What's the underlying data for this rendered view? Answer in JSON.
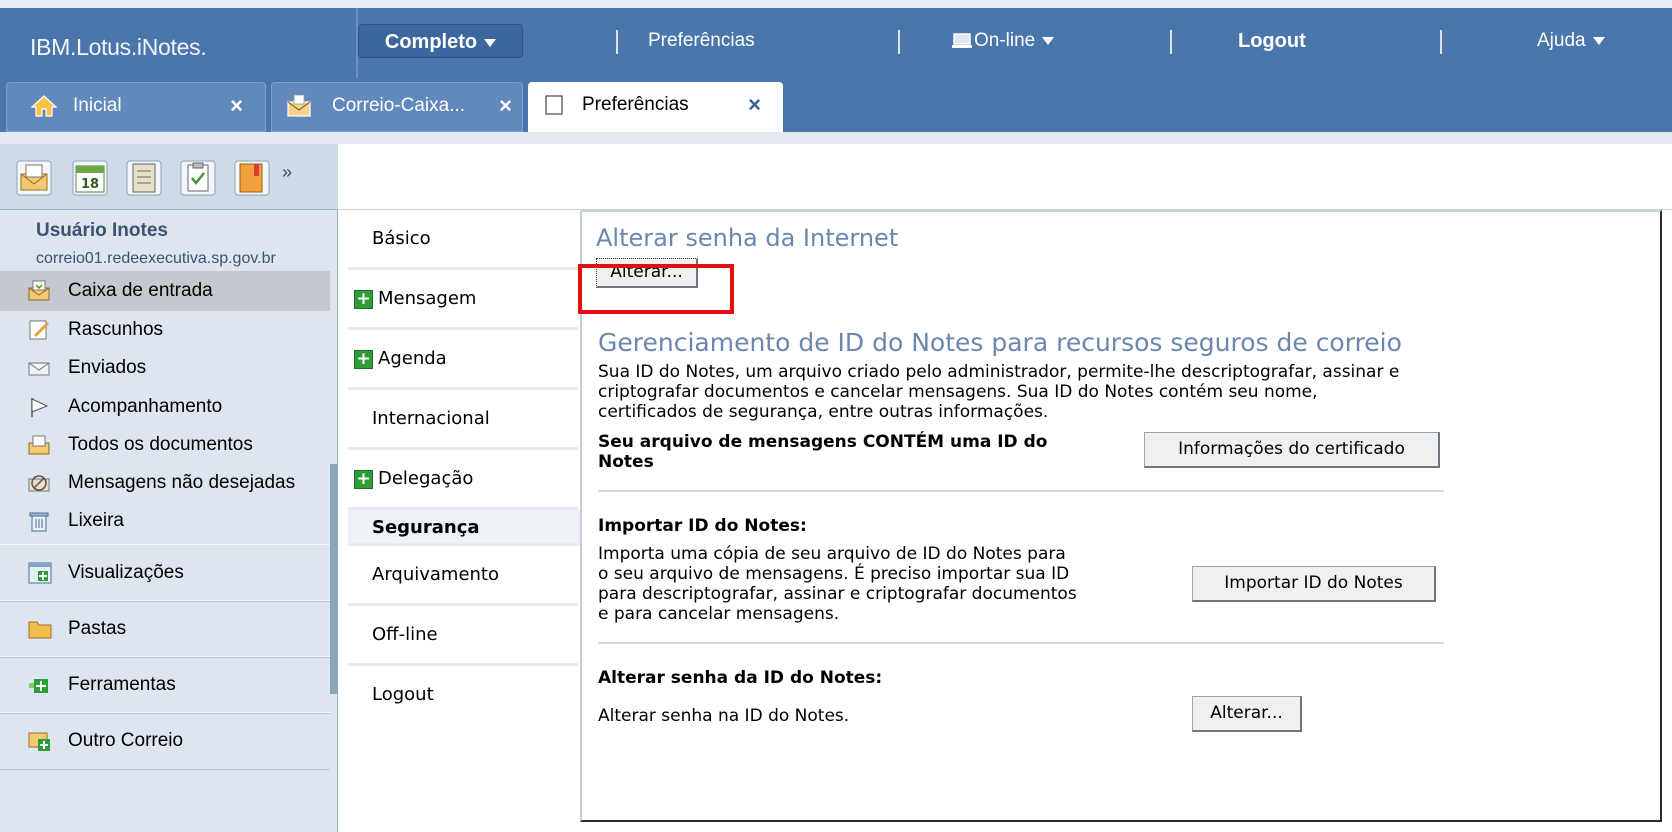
{
  "topbar": {
    "logo": "IBM.Lotus.iNotes.",
    "completo": "Completo",
    "preferencias": "Preferências",
    "online": "On-line",
    "logout": "Logout",
    "ajuda": "Ajuda"
  },
  "tabs": [
    {
      "label": "Inicial",
      "icon": "home-icon"
    },
    {
      "label": "Correio-Caixa...",
      "icon": "mail-icon"
    },
    {
      "label": "Preferências",
      "icon": "document-icon"
    }
  ],
  "tab_close": "×",
  "launcher": {
    "calendar_day": "18",
    "more": "»"
  },
  "user": {
    "name": "Usuário Inotes",
    "host": "correio01.redeexecutiva.sp.gov.br"
  },
  "nav_items": [
    {
      "label": "Caixa de entrada",
      "icon": "inbox-icon"
    },
    {
      "label": "Rascunhos",
      "icon": "drafts-icon"
    },
    {
      "label": "Enviados",
      "icon": "sent-icon"
    },
    {
      "label": "Acompanhamento",
      "icon": "flag-icon"
    },
    {
      "label": "Todos os documentos",
      "icon": "all-documents-icon"
    },
    {
      "label": "Mensagens não desejadas",
      "icon": "junk-icon"
    },
    {
      "label": "Lixeira",
      "icon": "trash-icon"
    }
  ],
  "sections": [
    {
      "label": "Visualizações",
      "icon": "views-icon"
    },
    {
      "label": "Pastas",
      "icon": "folder-icon"
    },
    {
      "label": "Ferramentas",
      "icon": "tools-icon"
    },
    {
      "label": "Outro Correio",
      "icon": "other-mail-icon"
    }
  ],
  "pref_nav": {
    "basico": "Básico",
    "mensagem": "Mensagem",
    "agenda": "Agenda",
    "internacional": "Internacional",
    "delegacao": "Delegação",
    "seguranca": "Segurança",
    "arquivamento": "Arquivamento",
    "offline": "Off-line",
    "logout": "Logout"
  },
  "panel": {
    "internet_title": "Alterar senha da Internet",
    "internet_button": "Alterar...",
    "id_title": "Gerenciamento de ID do Notes para recursos seguros de correio",
    "id_desc_1": "Sua ID do Notes, um arquivo criado pelo administrador, permite-lhe descriptografar, assinar e",
    "id_desc_2": "criptografar documentos e cancelar mensagens. Sua ID do Notes contém seu nome,",
    "id_desc_3": "certificados de segurança, entre outras informações.",
    "contains_1": "Seu arquivo de mensagens CONTÉM uma ID do",
    "contains_2": "Notes",
    "cert_button": "Informações do certificado",
    "import_title": "Importar ID do Notes:",
    "import_1": "Importa uma cópia de seu arquivo de ID do Notes para",
    "import_2": "o seu arquivo de mensagens. É preciso importar sua ID",
    "import_3": "para descriptografar, assinar e criptografar documentos",
    "import_4": "e para cancelar mensagens.",
    "import_button": "Importar ID do Notes",
    "change_title": "Alterar senha da ID do Notes:",
    "change_desc": "Alterar senha na ID do Notes.",
    "change_button": "Alterar..."
  },
  "colors": {
    "header_blue": "#4a76ac",
    "heading_blue": "#6b87ad",
    "highlight_red": "#e01010",
    "plus_green": "#2f9d37"
  }
}
